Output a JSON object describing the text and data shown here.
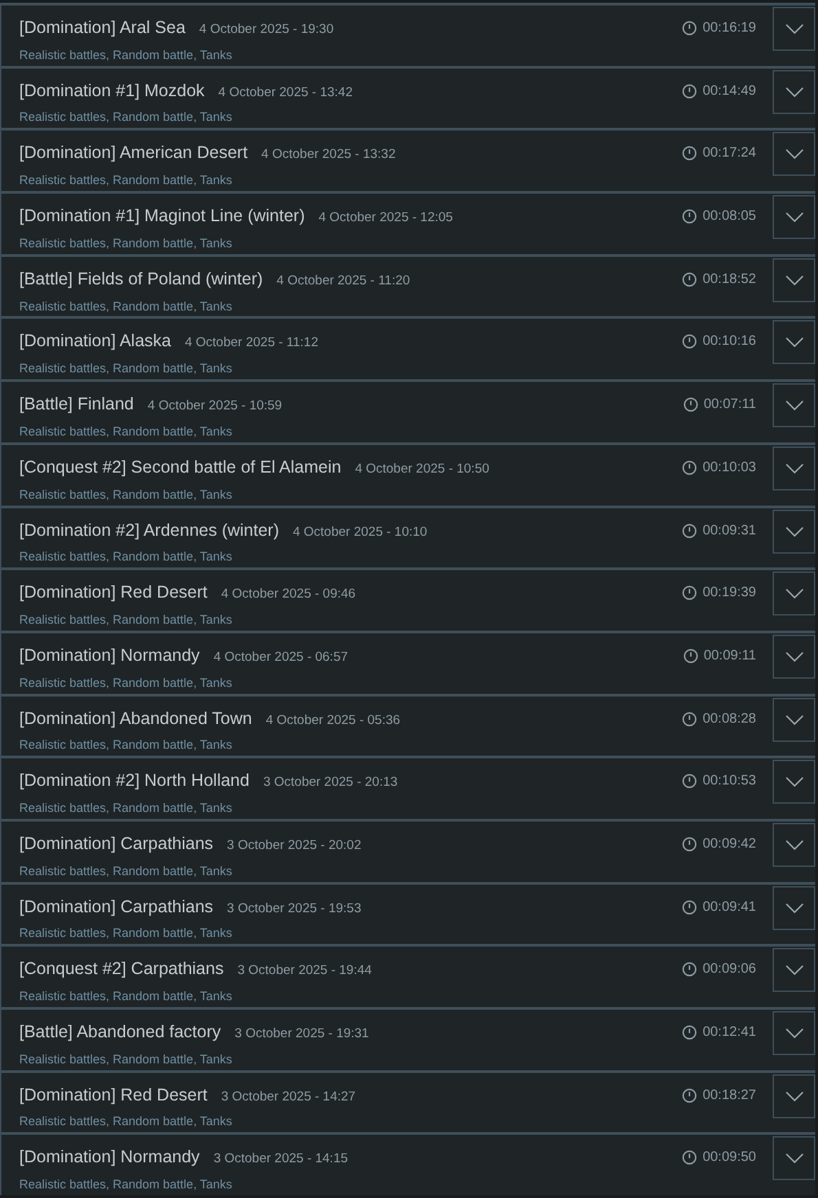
{
  "battles": [
    {
      "title": "[Domination] Aral Sea",
      "date": "4 October 2025 - 19:30",
      "tags": "Realistic battles, Random battle, Tanks",
      "duration": "00:16:19"
    },
    {
      "title": "[Domination #1] Mozdok",
      "date": "4 October 2025 - 13:42",
      "tags": "Realistic battles, Random battle, Tanks",
      "duration": "00:14:49"
    },
    {
      "title": "[Domination] American Desert",
      "date": "4 October 2025 - 13:32",
      "tags": "Realistic battles, Random battle, Tanks",
      "duration": "00:17:24"
    },
    {
      "title": "[Domination #1] Maginot Line (winter)",
      "date": "4 October 2025 - 12:05",
      "tags": "Realistic battles, Random battle, Tanks",
      "duration": "00:08:05"
    },
    {
      "title": "[Battle] Fields of Poland (winter)",
      "date": "4 October 2025 - 11:20",
      "tags": "Realistic battles, Random battle, Tanks",
      "duration": "00:18:52"
    },
    {
      "title": "[Domination] Alaska",
      "date": "4 October 2025 - 11:12",
      "tags": "Realistic battles, Random battle, Tanks",
      "duration": "00:10:16"
    },
    {
      "title": "[Battle] Finland",
      "date": "4 October 2025 - 10:59",
      "tags": "Realistic battles, Random battle, Tanks",
      "duration": "00:07:11"
    },
    {
      "title": "[Conquest #2] Second battle of El Alamein",
      "date": "4 October 2025 - 10:50",
      "tags": "Realistic battles, Random battle, Tanks",
      "duration": "00:10:03"
    },
    {
      "title": "[Domination #2] Ardennes (winter)",
      "date": "4 October 2025 - 10:10",
      "tags": "Realistic battles, Random battle, Tanks",
      "duration": "00:09:31"
    },
    {
      "title": "[Domination] Red Desert",
      "date": "4 October 2025 - 09:46",
      "tags": "Realistic battles, Random battle, Tanks",
      "duration": "00:19:39"
    },
    {
      "title": "[Domination] Normandy",
      "date": "4 October 2025 - 06:57",
      "tags": "Realistic battles, Random battle, Tanks",
      "duration": "00:09:11"
    },
    {
      "title": "[Domination] Abandoned Town",
      "date": "4 October 2025 - 05:36",
      "tags": "Realistic battles, Random battle, Tanks",
      "duration": "00:08:28"
    },
    {
      "title": "[Domination #2] North Holland",
      "date": "3 October 2025 - 20:13",
      "tags": "Realistic battles, Random battle, Tanks",
      "duration": "00:10:53"
    },
    {
      "title": "[Domination] Carpathians",
      "date": "3 October 2025 - 20:02",
      "tags": "Realistic battles, Random battle, Tanks",
      "duration": "00:09:42"
    },
    {
      "title": "[Domination] Carpathians",
      "date": "3 October 2025 - 19:53",
      "tags": "Realistic battles, Random battle, Tanks",
      "duration": "00:09:41"
    },
    {
      "title": "[Conquest #2] Carpathians",
      "date": "3 October 2025 - 19:44",
      "tags": "Realistic battles, Random battle, Tanks",
      "duration": "00:09:06"
    },
    {
      "title": "[Battle] Abandoned factory",
      "date": "3 October 2025 - 19:31",
      "tags": "Realistic battles, Random battle, Tanks",
      "duration": "00:12:41"
    },
    {
      "title": "[Domination] Red Desert",
      "date": "3 October 2025 - 14:27",
      "tags": "Realistic battles, Random battle, Tanks",
      "duration": "00:18:27"
    },
    {
      "title": "[Domination] Normandy",
      "date": "3 October 2025 - 14:15",
      "tags": "Realistic battles, Random battle, Tanks",
      "duration": "00:09:50"
    }
  ]
}
